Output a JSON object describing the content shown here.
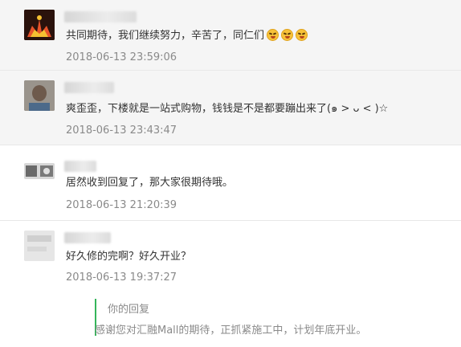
{
  "comments": [
    {
      "text": "共同期待，我们继续努力，辛苦了，同仁们",
      "emojis": [
        "laugh-emoji",
        "laugh-emoji",
        "laugh-emoji"
      ],
      "time": "2018-06-13 23:59:06"
    },
    {
      "text": "爽歪歪，下楼就是一站式购物，钱钱是不是都要蹦出来了(๑ > ᴗ < )☆",
      "time": "2018-06-13 23:43:47"
    },
    {
      "text": "居然收到回复了，那大家很期待哦。",
      "time": "2018-06-13 21:20:39"
    },
    {
      "text": "好久修的完啊？好久开业？",
      "time": "2018-06-13 19:37:27",
      "reply": {
        "label": "你的回复",
        "text": "感谢您对汇融Mall的期待，正抓紧施工中，计划年底开业。"
      }
    }
  ],
  "colors": {
    "reply_accent": "#35b55a",
    "row_shade": "#f5f5f5",
    "timestamp": "#8a8a8a"
  }
}
